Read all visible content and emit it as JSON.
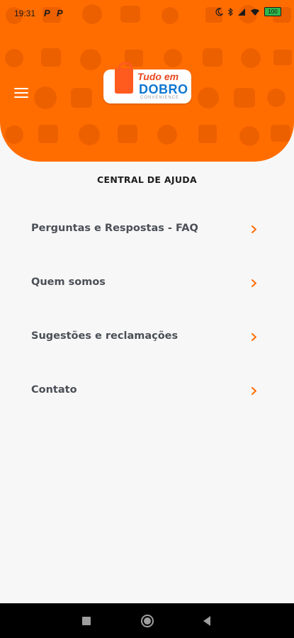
{
  "status_bar": {
    "time": "19:31",
    "app_icon_1": "P",
    "app_icon_2": "P",
    "battery_label": "100"
  },
  "header": {
    "logo_line1": "Tudo em",
    "logo_line2": "DOBRO",
    "logo_line3": "CONVENIENCE",
    "brand_color": "#ff6d00"
  },
  "page": {
    "title": "CENTRAL DE AJUDA"
  },
  "menu_items": [
    {
      "label": "Perguntas e Respostas - FAQ"
    },
    {
      "label": "Quem somos"
    },
    {
      "label": "Sugestões e reclamações"
    },
    {
      "label": "Contato"
    }
  ],
  "colors": {
    "chevron": "#ff6d00",
    "background": "#f7f7f8",
    "navbar": "#000000"
  }
}
